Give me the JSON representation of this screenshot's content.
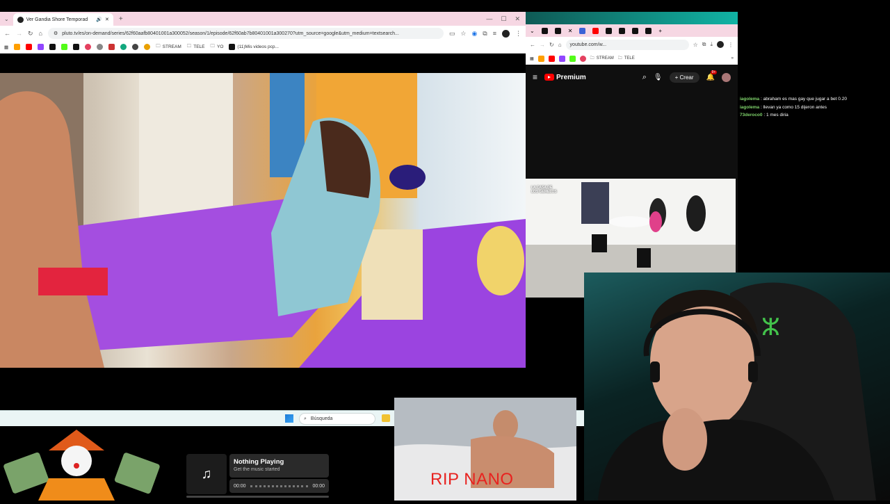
{
  "left_browser": {
    "tab_title": "Ver Gandia Shore Temporad",
    "url": "pluto.tv/es/on-demand/series/62f60aafb80401001a300052/season/1/episode/62f60ab7b80401001a300270?utm_source=google&utm_medium=textsearch...",
    "bookmarks": [
      "STREAM",
      "TELE",
      "YO",
      "(11)Mis videos pcp..."
    ]
  },
  "right_browser": {
    "url": "youtube.com/w...",
    "bookmarks": [
      "STREAM",
      "TELE"
    ],
    "yt_brand": "Premium",
    "create_label": "Crear",
    "notif_count": "9+",
    "video_watermark": "LA CASA DE LOS GEMELOS"
  },
  "chat": [
    {
      "user": "iagolema",
      "text": ": abraham es mas gay que jugar a bet 0.20"
    },
    {
      "user": "iagolema",
      "text": ": llevan ya como 15 dijeron antes"
    },
    {
      "user": "73deroco0",
      "text": ": 1 mes diria"
    }
  ],
  "taskbar": {
    "search_placeholder": "Búsqueda"
  },
  "music": {
    "title": "Nothing Playing",
    "subtitle": "Get the music started",
    "time_start": "00:00",
    "time_end": "00:00"
  },
  "rip_text": "RIP NANO",
  "colors": {
    "youtube_red": "#ff0000",
    "chat_user": "#7fd36b",
    "rip_red": "#e8221f",
    "tabbar_pink": "#f6d7e3"
  }
}
